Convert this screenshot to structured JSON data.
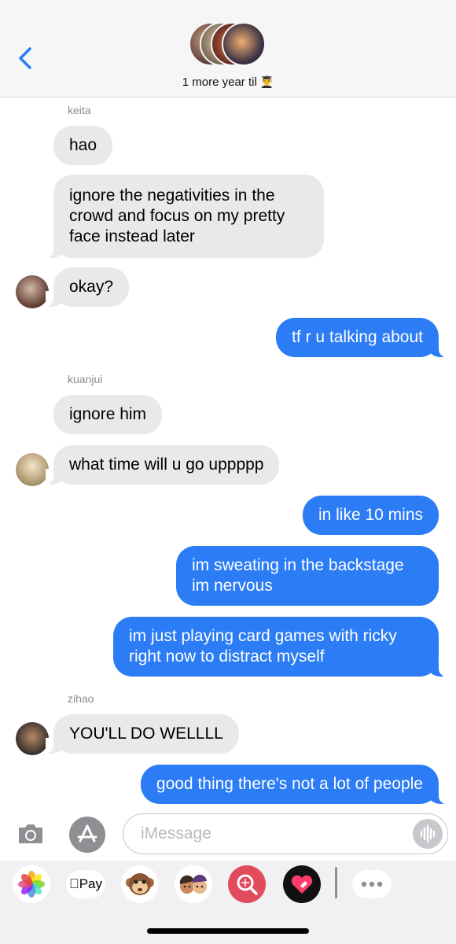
{
  "header": {
    "back_icon": "chevron-left-icon",
    "title": "1 more year til",
    "title_emoji": "👨‍🎓"
  },
  "thread": {
    "messages": [
      {
        "sender": "keita"
      },
      {
        "text": "hao"
      },
      {
        "text": "ignore the negativities in the crowd and focus on my pretty face instead later"
      },
      {
        "text": "okay?"
      },
      {
        "text": "tf r u talking about"
      },
      {
        "sender": "kuanjui"
      },
      {
        "text": "ignore him"
      },
      {
        "text": "what time will u go uppppp"
      },
      {
        "text": "in like 10 mins"
      },
      {
        "text": "im sweating in the backstage im nervous"
      },
      {
        "text": "im just playing card games with ricky right now to distract myself"
      },
      {
        "sender": "zihao"
      },
      {
        "text": "YOU'LL DO WELLLL"
      },
      {
        "text": "good thing there's not a lot of people"
      }
    ]
  },
  "compose": {
    "placeholder": "iMessage",
    "camera_icon": "camera-icon",
    "appstore_icon": "app-store-icon",
    "audio_icon": "audio-waveform-icon"
  },
  "drawer": {
    "pay_label": "Pay",
    "apps": [
      "photos-icon",
      "apple-pay-icon",
      "monkey-emoji-icon",
      "memoji-icon",
      "image-search-icon",
      "digital-touch-icon",
      "more-icon"
    ]
  },
  "colors": {
    "outgoing_bubble": "#2b7cf5",
    "incoming_bubble": "#e9e9eb",
    "accent": "#2b7cf5"
  }
}
